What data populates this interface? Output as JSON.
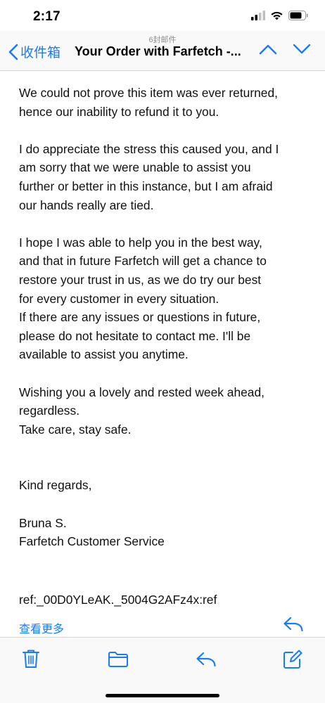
{
  "status_bar": {
    "time": "2:17",
    "icons": [
      "cellular-signal-icon",
      "wifi-icon",
      "battery-icon"
    ]
  },
  "nav": {
    "mail_count": "6封邮件",
    "back_label": "收件箱",
    "title": "Your Order with Farfetch -...",
    "icons": [
      "chevron-left-icon",
      "chevron-up-icon",
      "chevron-down-icon"
    ]
  },
  "email": {
    "p1_l1": "We could not prove this item was ever returned,",
    "p1_l2": "hence our inability to refund it to you.",
    "p2_l1": "I do appreciate the stress this caused you, and I",
    "p2_l2": "am sorry that we were unable to assist you",
    "p2_l3": "further or better in this instance, but I am afraid",
    "p2_l4": "our hands really are tied.",
    "p3_l1": "I hope I was able to help you in the best way,",
    "p3_l2": "and that in future Farfetch will get a chance to",
    "p3_l3": "restore your trust in us, as we do try our best",
    "p3_l4": "for every customer in every situation.",
    "p3_l5": "If there are any issues or questions in future,",
    "p3_l6": "please do not hesitate to contact me. I'll be",
    "p3_l7": "available to assist you anytime.",
    "p4_l1": "Wishing you a lovely and rested week ahead,",
    "p4_l2": "regardless.",
    "p4_l3": "Take care, stay safe.",
    "closing": "Kind regards,",
    "sig_name": "Bruna S.",
    "sig_team": "Farfetch Customer Service",
    "ref": "ref:_00D0YLeAK._5004G2AFz4x:ref"
  },
  "see_more": "查看更多",
  "toolbar": {
    "icons": [
      "trash-icon",
      "folder-icon",
      "reply-icon",
      "compose-icon"
    ]
  },
  "colors": {
    "accent": "#1a7cf5",
    "text": "#111111",
    "bar_bg": "#f9f9f9"
  }
}
